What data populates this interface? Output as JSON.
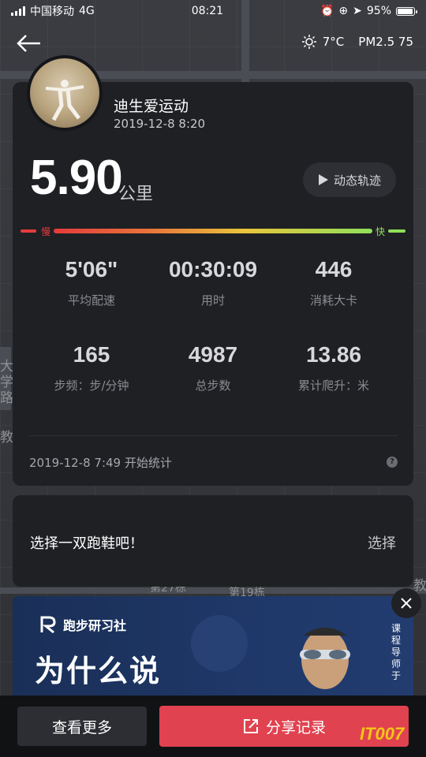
{
  "status_bar": {
    "carrier": "中国移动",
    "network": "4G",
    "time": "08:21",
    "battery": "95%",
    "battery_level": 0.95
  },
  "nav": {
    "weather_temp": "7°C",
    "air_quality": "PM2.5 75"
  },
  "map_labels": [
    "大",
    "学",
    "路",
    "教",
    "第19栋",
    "第27栋",
    "教"
  ],
  "workout": {
    "user_name": "迪生爱运动",
    "user_date": "2019-12-8 8:20",
    "distance": "5.90",
    "distance_unit": "公里",
    "track_button": "动态轨迹",
    "speed_slow": "慢",
    "speed_fast": "快",
    "stats": [
      {
        "value": "5'06\"",
        "label": "平均配速"
      },
      {
        "value": "00:30:09",
        "label": "用时"
      },
      {
        "value": "446",
        "label": "消耗大卡"
      },
      {
        "value": "165",
        "label": "步频：步/分钟"
      },
      {
        "value": "4987",
        "label": "总步数"
      },
      {
        "value": "13.86",
        "label": "累计爬升：米"
      }
    ],
    "start_stat": "2019-12-8 7:49 开始统计",
    "help": "?"
  },
  "shoe": {
    "prompt": "选择一双跑鞋吧！",
    "select": "选择"
  },
  "ad": {
    "brand": "跑步研习社",
    "headline": "为什么说",
    "headline2": "...",
    "vertical_text": "课程导师 于",
    "close": "×"
  },
  "bottom": {
    "more_button": "查看更多",
    "share_button": "分享记录"
  },
  "watermark": "IT007",
  "colors": {
    "accent_red": "#e0424f",
    "card_bg": "#1f2024",
    "speed_slow": "#e53b3b",
    "speed_fast": "#8ee05a"
  }
}
